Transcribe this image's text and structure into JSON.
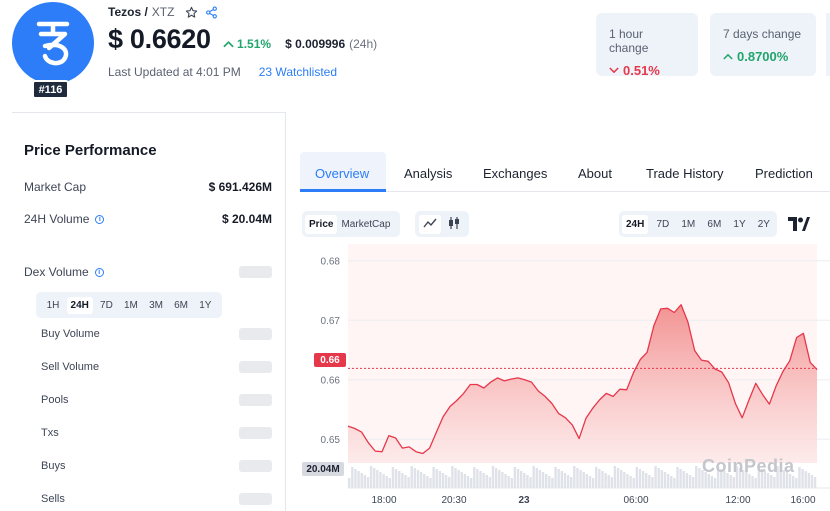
{
  "coin": {
    "name": "Tezos /",
    "symbol": "XTZ",
    "rank": "#116",
    "price": "$ 0.6620",
    "change_24h": "1.51%",
    "btc_price": "$ 0.009996",
    "btc_period": "(24h)",
    "last_updated": "Last Updated at 4:01 PM",
    "watchlisted": "23 Watchlisted",
    "brand_color": "#2c7df7"
  },
  "change_cards": {
    "hour": {
      "label": "1 hour change",
      "value": "0.51%",
      "direction": "down"
    },
    "week": {
      "label": "7 days change",
      "value": "0.8700%",
      "direction": "up"
    }
  },
  "performance": {
    "title": "Price Performance",
    "market_cap_label": "Market Cap",
    "market_cap_value": "$ 691.426M",
    "volume_label": "24H Volume",
    "volume_value": "$ 20.04M",
    "dex_volume_label": "Dex Volume",
    "ranges": [
      "1H",
      "24H",
      "7D",
      "1M",
      "3M",
      "6M",
      "1Y"
    ],
    "active_range": "24H",
    "rows": [
      "Buy Volume",
      "Sell Volume",
      "Pools",
      "Txs",
      "Buys",
      "Sells"
    ]
  },
  "tabs": [
    "Overview",
    "Analysis",
    "Exchanges",
    "About",
    "Trade History",
    "Prediction"
  ],
  "chart_controls": {
    "type_toggle": [
      "Price",
      "MarketCap"
    ],
    "periods": [
      "24H",
      "7D",
      "1M",
      "6M",
      "1Y",
      "2Y"
    ],
    "active_period": "24H"
  },
  "chart_data": {
    "type": "area",
    "y_ticks": [
      "0.68",
      "0.67",
      "0.66",
      "0.65"
    ],
    "x_ticks": [
      "18:00",
      "20:30",
      "23",
      "06:00",
      "12:00",
      "16:00"
    ],
    "ylim": [
      0.646,
      0.6818
    ],
    "current_price_label": "0.66",
    "current_price": 0.6619,
    "volume_label": "20.04M",
    "watermark": "CoinPedia",
    "line_color": "#e5384b",
    "series": [
      {
        "values": [
          0.6522,
          0.6518,
          0.6512,
          0.6494,
          0.648,
          0.6479,
          0.6506,
          0.6502,
          0.6485,
          0.6487,
          0.6479,
          0.6476,
          0.6485,
          0.6512,
          0.6538,
          0.6555,
          0.6565,
          0.6577,
          0.6592,
          0.6592,
          0.6586,
          0.6596,
          0.6603,
          0.6598,
          0.6601,
          0.6603,
          0.66,
          0.6596,
          0.6581,
          0.6572,
          0.656,
          0.6543,
          0.6536,
          0.6524,
          0.6501,
          0.6535,
          0.6552,
          0.6566,
          0.6577,
          0.6572,
          0.6584,
          0.6583,
          0.6612,
          0.6634,
          0.6646,
          0.6691,
          0.6719,
          0.672,
          0.6713,
          0.6726,
          0.6697,
          0.6649,
          0.6633,
          0.6631,
          0.6618,
          0.6613,
          0.6595,
          0.656,
          0.6536,
          0.6566,
          0.6594,
          0.6575,
          0.6559,
          0.659,
          0.6614,
          0.6632,
          0.6671,
          0.6678,
          0.6629,
          0.6617
        ]
      }
    ]
  }
}
